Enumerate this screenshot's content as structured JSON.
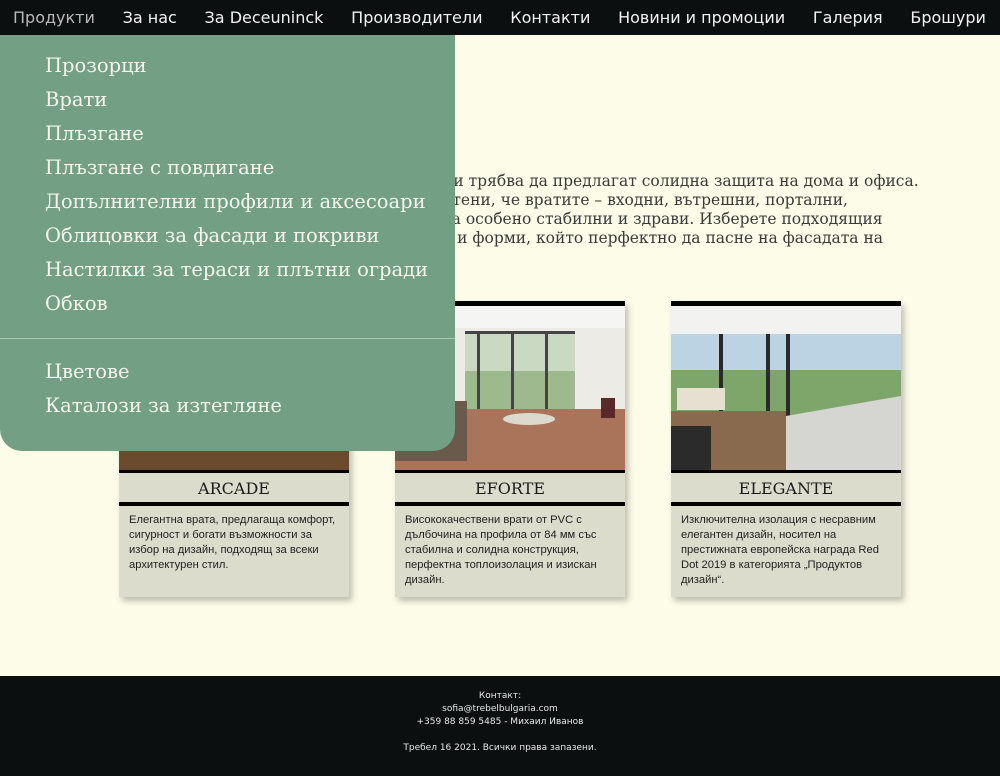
{
  "nav": {
    "items": [
      {
        "label": "Продукти",
        "active": true
      },
      {
        "label": "За нас"
      },
      {
        "label": "За Deceuninck"
      },
      {
        "label": "Производители"
      },
      {
        "label": "Контакти"
      },
      {
        "label": "Новини и промоции"
      },
      {
        "label": "Галерия"
      },
      {
        "label": "Брошури"
      }
    ]
  },
  "dropdown": {
    "items": [
      "Прозорци",
      "Врати",
      "Плъзгане",
      "Плъзгане с повдигане",
      "Допълнителни профили и аксесоари",
      "Облицовки за фасади и покриви",
      "Настилки за тераси и плътни огради",
      "Обков"
    ],
    "extra_items": [
      "Цветове",
      "Каталози за изтегляне"
    ]
  },
  "intro": {
    "lines": [
      "ни трябва да предлагат солидна защита на дома и офиса.",
      "отени, че вратите – входни, вътрешни, портални,",
      "са особено стабилни и здрави. Изберете подходящия",
      "е и форми, който перфектно да пасне на фасадата на"
    ]
  },
  "cards": [
    {
      "title": "ARCADE",
      "desc": "Елегантна врата, предлагаща комфорт, сигурност и богати възможности за избор на дизайн, подходящ за всеки архитектурен стил."
    },
    {
      "title": "EFORTE",
      "desc": "Висококачествени врати от PVC с дълбочина на профила от 84 мм със стабилна и солидна конструкция, перфектна топлоизолация и изискан дизайн."
    },
    {
      "title": "ELEGANTE",
      "desc": "Изключителна изолация с несравним елегантен дизайн, носител на престижната европейска награда Red Dot 2019 в категорията „Продуктов дизайн“."
    }
  ],
  "footer": {
    "contact_label": "Контакт:",
    "email": "sofia@trebelbulgaria.com",
    "phone": "+359 88 859 5485 - Михаил Иванов",
    "copyright": "Требел 16 2021. Всички права запазени."
  },
  "colors": {
    "nav_bg": "#0b0f0f",
    "page_bg": "#fdfce8",
    "dropdown_bg": "#739f84",
    "card_bg": "#dcdccd"
  }
}
